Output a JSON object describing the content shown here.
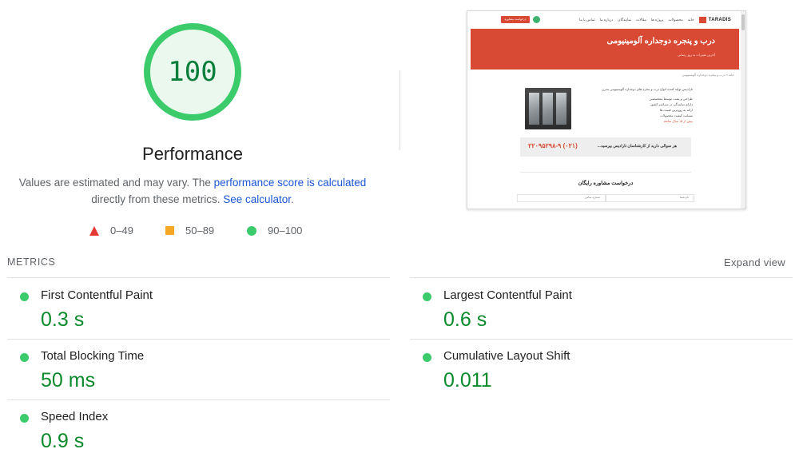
{
  "score": {
    "value": "100",
    "percent": 100,
    "ring_color": "#3bcb6a",
    "fill_color": "#eaf8ee",
    "text_color": "#0a7e3a"
  },
  "performance": {
    "title": "Performance",
    "desc_prefix": "Values are estimated and may vary. The ",
    "score_link": "performance score is calculated",
    "desc_middle": " directly from these metrics. ",
    "calc_link": "See calculator",
    "desc_suffix": "."
  },
  "legend": [
    {
      "range": "0–49",
      "shape": "triangle",
      "color": "#e53935"
    },
    {
      "range": "50–89",
      "shape": "square",
      "color": "#f4a825"
    },
    {
      "range": "90–100",
      "shape": "circle",
      "color": "#3bcb6a"
    }
  ],
  "thumbnail": {
    "logo_text": "TARADIS",
    "menu": [
      "خانه",
      "محصولات",
      "پروژه ها",
      "مقالات",
      "نمایندگان",
      "درباره ما",
      "تماس با ما"
    ],
    "cta_label": "درخواست مشاوره",
    "hero_title": "درب و پنجره دوجداره آلومینیومی",
    "hero_subtitle": "آخرین تغییرات به روز رسانی",
    "breadcrumb": "خانه » درب و پنجره دوجداره آلومینیومی",
    "intro": "تارادیس تولید کننده انواع درب و پنجره های دوجداره آلومینیومی مدرن",
    "bullets": [
      "طراحی و نصب توسط متخصصین",
      "دارای نمایندگی در سراسر کشور",
      "ارائه به روزترین قیمت ها",
      "ضمانت کیفیت محصولات",
      "بیش از ۱۵ سال سابقه"
    ],
    "call_question": "هر سوالی دارید از کارشناسان تارادیس بپرسید...",
    "call_phone": "(۰۲۱) ۲۲۰۹۵۲۹۸-۹",
    "form_title": "درخواست مشاوره رایگان",
    "form_fields": [
      "نام شما",
      "شماره تماس"
    ]
  },
  "metrics_section": {
    "label": "METRICS",
    "expand": "Expand view"
  },
  "metrics": [
    {
      "title": "First Contentful Paint",
      "value": "0.3 s",
      "status": "good"
    },
    {
      "title": "Largest Contentful Paint",
      "value": "0.6 s",
      "status": "good"
    },
    {
      "title": "Total Blocking Time",
      "value": "50 ms",
      "status": "good"
    },
    {
      "title": "Cumulative Layout Shift",
      "value": "0.011",
      "status": "good"
    },
    {
      "title": "Speed Index",
      "value": "0.9 s",
      "status": "good"
    }
  ]
}
